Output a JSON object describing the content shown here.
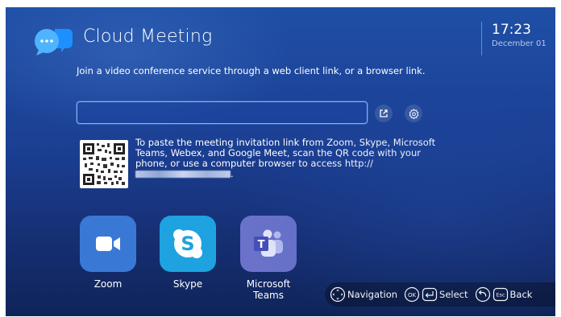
{
  "header": {
    "title": "Cloud Meeting",
    "time": "17:23",
    "date": "December 01"
  },
  "main": {
    "description": "Join a video conference service through a web client link, or a browser link.",
    "link_input": {
      "value": "",
      "placeholder": ""
    },
    "instructions_prefix": "To paste the meeting invitation link from Zoom, Skype, Microsoft Teams, Webex, and Google Meet, scan the QR code with your phone, or use a computer browser to access http://",
    "instructions_suffix": "."
  },
  "apps": [
    {
      "label": "Zoom",
      "color": "#3a78d6"
    },
    {
      "label": "Skype",
      "color": "#1ea3e0"
    },
    {
      "label": "Microsoft Teams",
      "color": "#6a72c9"
    }
  ],
  "hints": {
    "navigation": "Navigation",
    "ok_key": "OK",
    "select": "Select",
    "esc_key": "Esc",
    "back": "Back"
  },
  "icons": [
    "chat-bubble-icon",
    "open-external-icon",
    "settings-icon",
    "qr-code-icon",
    "zoom-camera-icon",
    "skype-icon",
    "teams-icon",
    "dpad-icon",
    "ok-key-icon",
    "enter-key-icon",
    "back-arrow-icon",
    "esc-key-icon"
  ],
  "colors": {
    "accent": "#2f8cff",
    "background": "#1b3f93",
    "input_border": "#7fb4ff"
  }
}
